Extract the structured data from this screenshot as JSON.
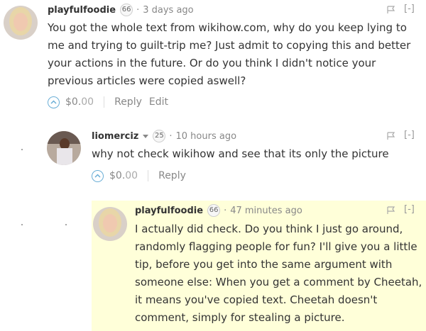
{
  "comments": [
    {
      "username": "playfulfoodie",
      "reputation": "66",
      "time": "3 days ago",
      "collapse": "[-]",
      "body": "You got the whole text from wikihow.com, why do you keep lying to me and trying to guilt-trip me? Just admit to copying this and better your actions in the future. Or do you think I didn't notice your previous articles were copied aswell?",
      "payout_main": "$0.",
      "payout_cents": "00",
      "reply": "Reply",
      "edit": "Edit"
    },
    {
      "username": "liomerciz",
      "reputation": "25",
      "time": "10 hours ago",
      "collapse": "[-]",
      "body": "why not check wikihow and see that its only the picture",
      "payout_main": "$0.",
      "payout_cents": "00",
      "reply": "Reply"
    },
    {
      "username": "playfulfoodie",
      "reputation": "66",
      "time": "47 minutes ago",
      "collapse": "[-]",
      "body": "I actually did check. Do you think I just go around, randomly flagging people for fun? I'll give you a little tip, before you get into the same argument with someone else: When you get a comment by Cheetah, it means you've copied text. Cheetah doesn't comment, simply for stealing a picture."
    }
  ],
  "separator": "·",
  "colors": {
    "highlight": "#ffffd9",
    "upvote_blue": "#6aaed6"
  }
}
